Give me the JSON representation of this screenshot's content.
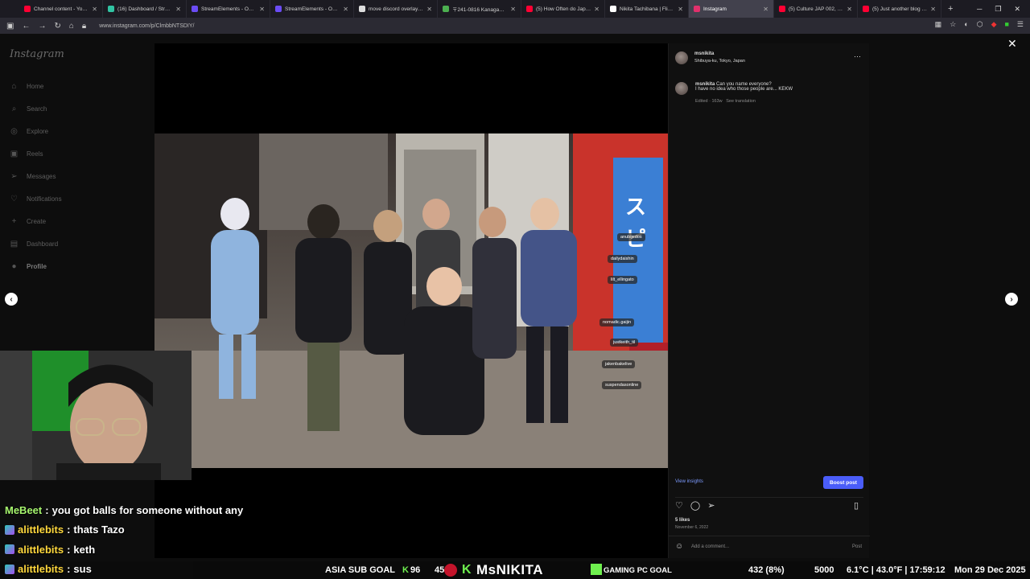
{
  "browser": {
    "tabs": [
      {
        "label": "Channel content - YouTube",
        "color": "#ff0033"
      },
      {
        "label": "(16) Dashboard / Streamlabs",
        "color": "#31c3a2"
      },
      {
        "label": "StreamElements - Overlays",
        "color": "#6b4cf5"
      },
      {
        "label": "StreamElements - Overlays",
        "color": "#6b4cf5"
      },
      {
        "label": "move discord overlay in game",
        "color": "#dddddd"
      },
      {
        "label": "〒241-0816 Kanagawa, Yokohama",
        "color": "#4caf50"
      },
      {
        "label": "(5) How Often do Japanese",
        "color": "#ff0033"
      },
      {
        "label": "Nikita Tachibana | Flickr",
        "color": "#ffffff"
      },
      {
        "label": "Instagram",
        "color": "#e1306c",
        "active": true
      },
      {
        "label": "(5) Culture JAP 002, Harajuku",
        "color": "#ff0033"
      },
      {
        "label": "(5) Just another blog - YouTube",
        "color": "#ff0033"
      }
    ],
    "url": "www.instagram.com/p/ClmbbNTSDIY/"
  },
  "instagram": {
    "logo": "Instagram",
    "nav": [
      {
        "label": "Home",
        "icon": "home-icon",
        "glyph": "⌂"
      },
      {
        "label": "Search",
        "icon": "search-icon",
        "glyph": "⌕"
      },
      {
        "label": "Explore",
        "icon": "explore-icon",
        "glyph": "◎"
      },
      {
        "label": "Reels",
        "icon": "reels-icon",
        "glyph": "▣"
      },
      {
        "label": "Messages",
        "icon": "messages-icon",
        "glyph": "➢"
      },
      {
        "label": "Notifications",
        "icon": "heart-icon",
        "glyph": "♡"
      },
      {
        "label": "Create",
        "icon": "plus-icon",
        "glyph": "+"
      },
      {
        "label": "Dashboard",
        "icon": "dashboard-icon",
        "glyph": "▤"
      },
      {
        "label": "Profile",
        "icon": "avatar-icon",
        "glyph": "●"
      }
    ],
    "post": {
      "username": "msnikita",
      "location": "Shibuya-ku, Tokyo, Japan",
      "caption_user": "msnikita",
      "caption_line1": "Can you name everyone?",
      "caption_line2": "I have no idea who those people are... KEKW",
      "meta": "Edited · 163w",
      "see_translation": "See translation",
      "view_insights": "View insights",
      "boost": "Boost post",
      "likes": "5 likes",
      "date": "November 6, 2022",
      "comment_placeholder": "Add a comment...",
      "post_btn": "Post",
      "tags": [
        "anubijedos",
        "dailydaishin",
        "lilt_ellingato",
        "nomadic.gaijin",
        "justkeith_til",
        "jakenbakelive",
        "suspendasonline"
      ]
    }
  },
  "stream": {
    "chat": [
      {
        "user": "MeBeet",
        "text": "you got balls for someone without any",
        "badge": false
      },
      {
        "user": "alittlebits",
        "text": "thats Tazo",
        "badge": true
      },
      {
        "user": "alittlebits",
        "text": "keth",
        "badge": true
      },
      {
        "user": "alittlebits",
        "text": "sus",
        "badge": true
      }
    ],
    "ticker": {
      "sub_goal_label": "ASIA SUB GOAL",
      "sub_goal_current": "96",
      "sub_goal_target": "450",
      "channel": "MsNIKITA",
      "pc_goal": "GAMING PC GOAL",
      "pc_progress": "432 (8%)",
      "pc_target": "5000",
      "weather": "6.1°C | 43.0°F | 17:59:12",
      "date": "Mon 29 Dec 2025"
    }
  }
}
